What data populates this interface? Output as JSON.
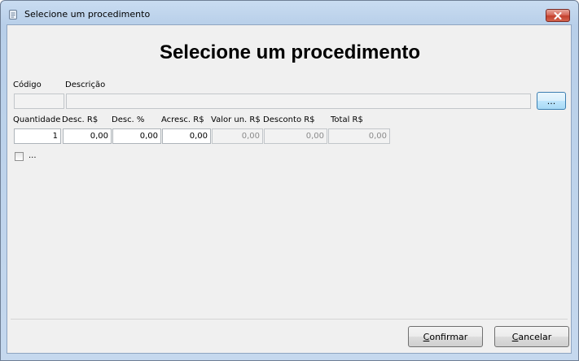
{
  "window": {
    "title": "Selecione um procedimento",
    "icon": "document-icon",
    "close_icon": "close-icon"
  },
  "form": {
    "heading": "Selecione um procedimento",
    "codigo": {
      "label": "Código",
      "value": ""
    },
    "descricao": {
      "label": "Descrição",
      "value": ""
    },
    "browse_button": "...",
    "quantidade": {
      "label": "Quantidade",
      "value": "1"
    },
    "desc_rs": {
      "label": "Desc. R$",
      "value": "0,00"
    },
    "desc_pct": {
      "label": "Desc. %",
      "value": "0,00"
    },
    "acresc_rs": {
      "label": "Acresc. R$",
      "value": "0,00"
    },
    "valor_un": {
      "label": "Valor un. R$",
      "value": "0,00"
    },
    "desconto_rs": {
      "label": "Desconto R$",
      "value": "0,00"
    },
    "total_rs": {
      "label": "Total R$",
      "value": "0,00"
    },
    "checkbox": {
      "label": "...",
      "checked": false
    }
  },
  "footer": {
    "confirm": {
      "label": "Confirmar",
      "accel": "C",
      "rest": "onfirmar"
    },
    "cancel": {
      "label": "Cancelar",
      "accel": "C",
      "rest": "ancelar"
    }
  },
  "colors": {
    "title_gradient_top": "#c9dcf1",
    "close_button": "#c2402d",
    "client_bg": "#f0f0f0",
    "focus_border": "#3c7fb1"
  }
}
